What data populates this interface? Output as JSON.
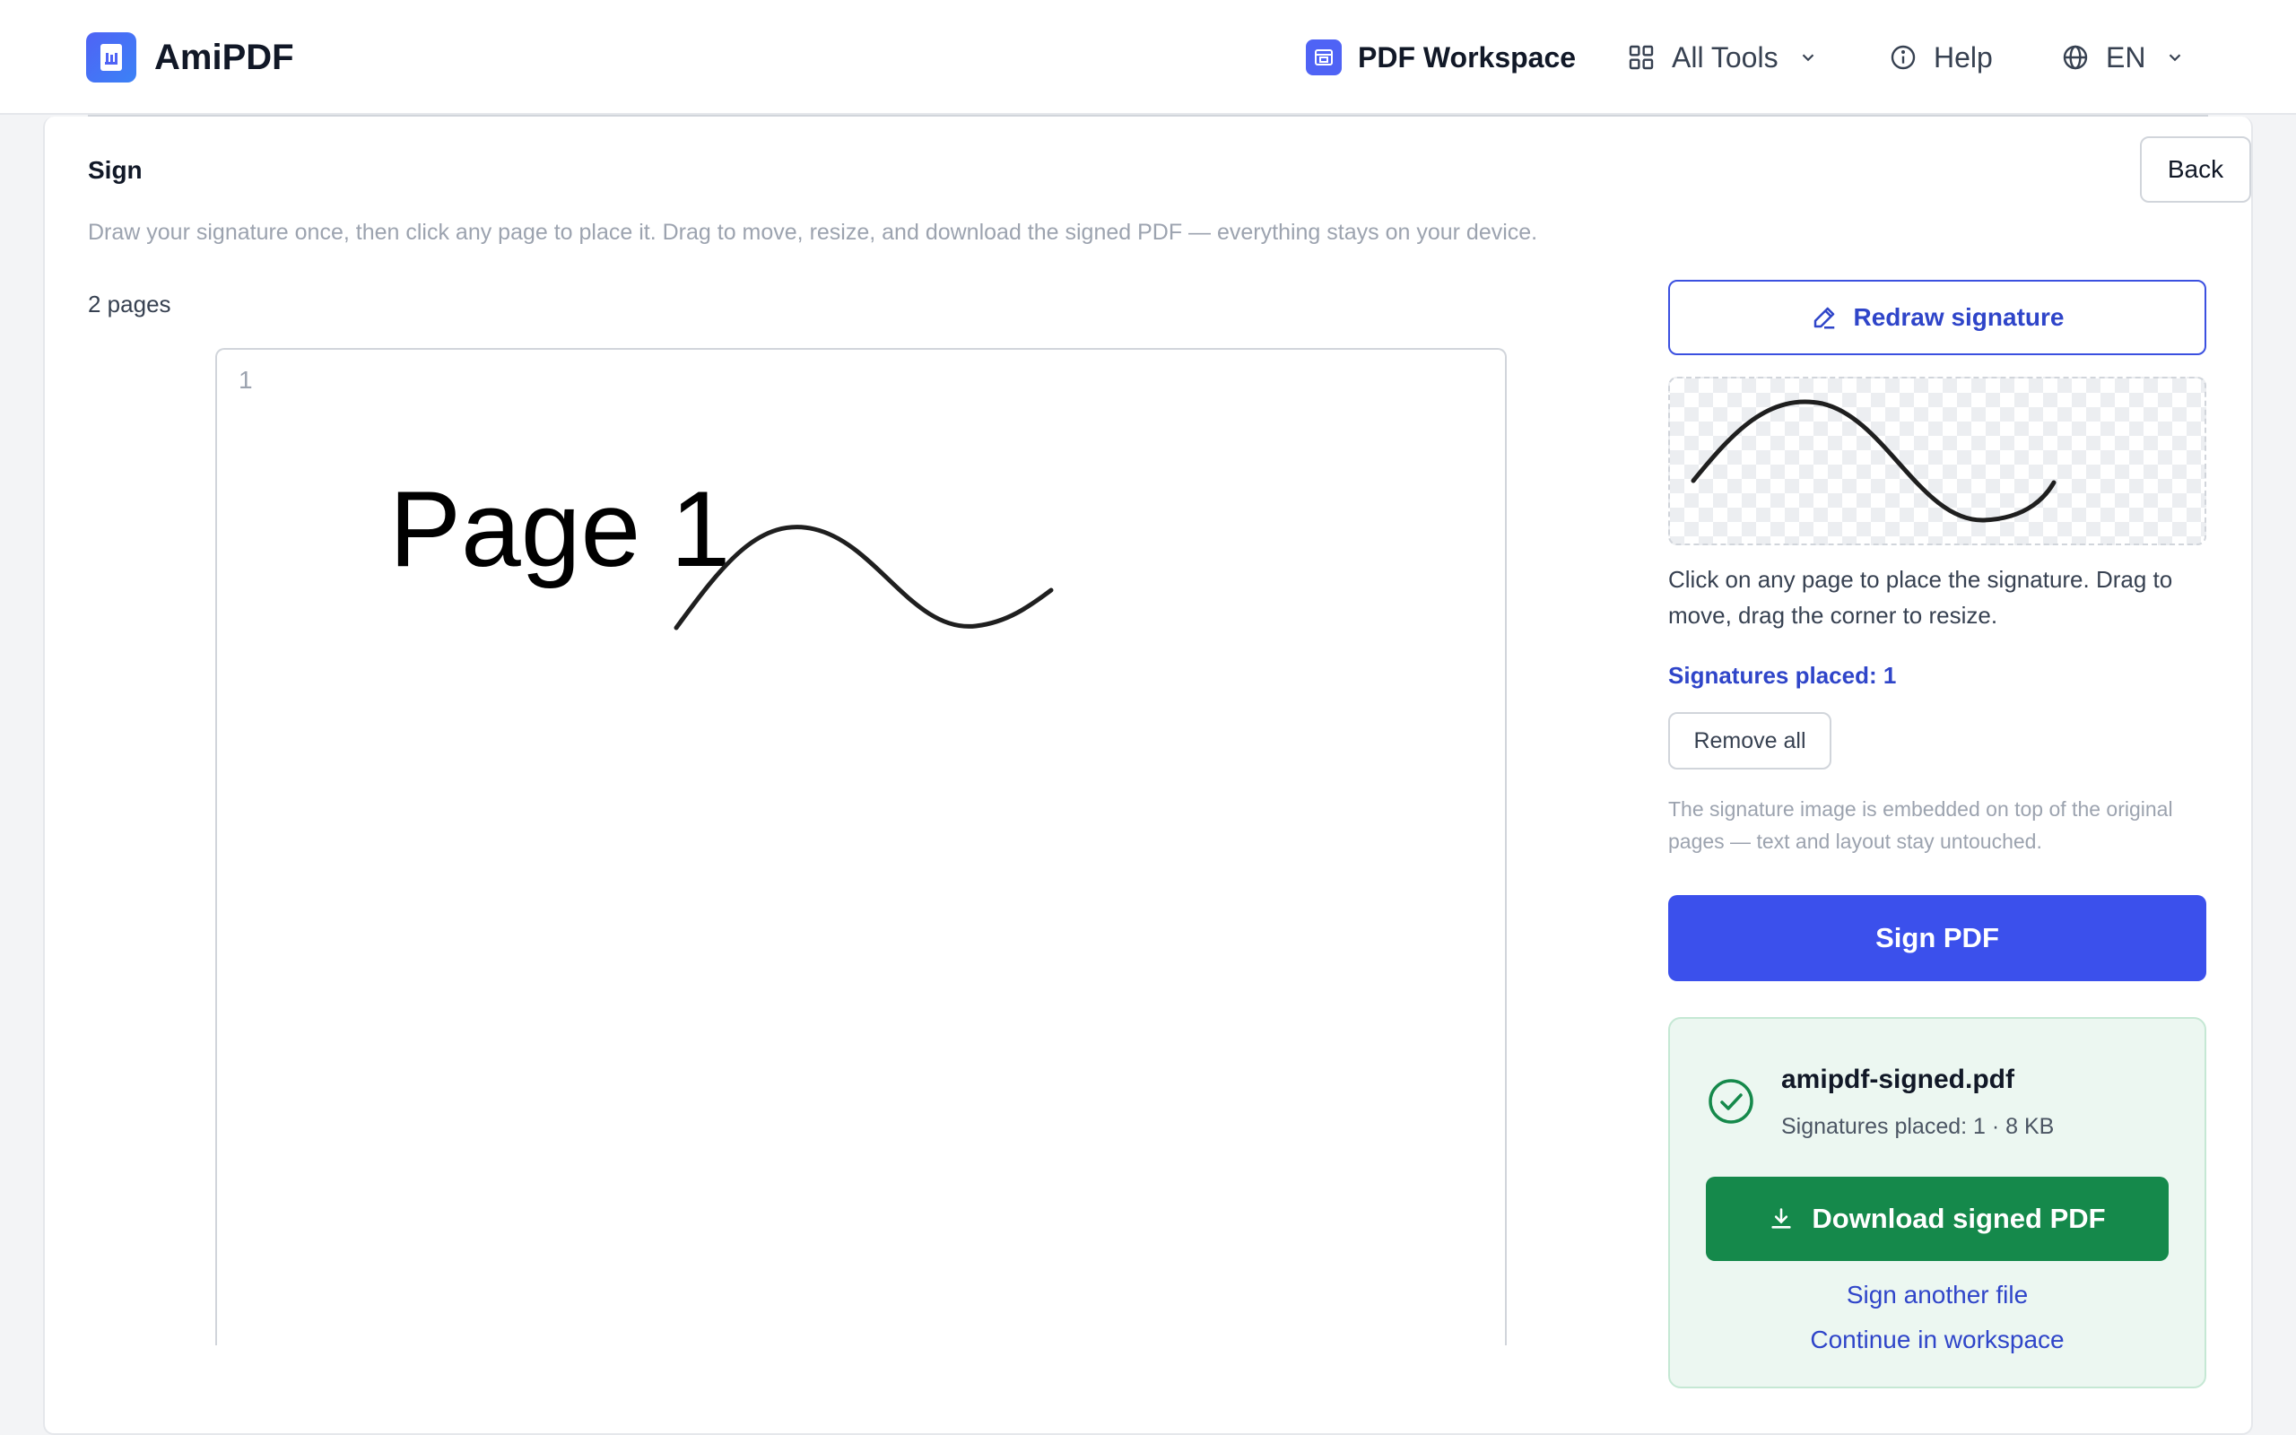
{
  "header": {
    "brand": "AmiPDF",
    "nav": {
      "workspace": "PDF Workspace",
      "all_tools": "All Tools",
      "help": "Help",
      "language": "EN"
    }
  },
  "tool": {
    "title": "Sign",
    "back_label": "Back",
    "description": "Draw your signature once, then click any page to place it. Drag to move, resize, and download the signed PDF — everything stays on your device.",
    "pages_count": "2 pages"
  },
  "preview": {
    "page_number": "1",
    "page_text": "Page 1"
  },
  "panel": {
    "redraw_label": "Redraw signature",
    "hint": "Click on any page to place the signature. Drag to move, drag the corner to resize.",
    "signatures_placed": "Signatures placed: 1",
    "remove_all_label": "Remove all",
    "note": "The signature image is embedded on top of the original pages — text and layout stay untouched.",
    "sign_label": "Sign PDF"
  },
  "result": {
    "filename": "amipdf-signed.pdf",
    "meta": "Signatures placed: 1 · 8 KB",
    "download_label": "Download signed PDF",
    "sign_another": "Sign another file",
    "continue": "Continue in workspace"
  },
  "colors": {
    "accent": "#3b50ec",
    "accent_text": "#2f45c9",
    "success": "#15894b",
    "success_bg": "#ecf7f1"
  },
  "icons": {
    "logo": "document-logo-icon",
    "workspace": "workspace-icon",
    "tools": "grid-icon",
    "help": "info-icon",
    "language": "globe-icon",
    "redraw": "pen-icon",
    "check": "check-circle-icon",
    "download": "download-icon"
  }
}
